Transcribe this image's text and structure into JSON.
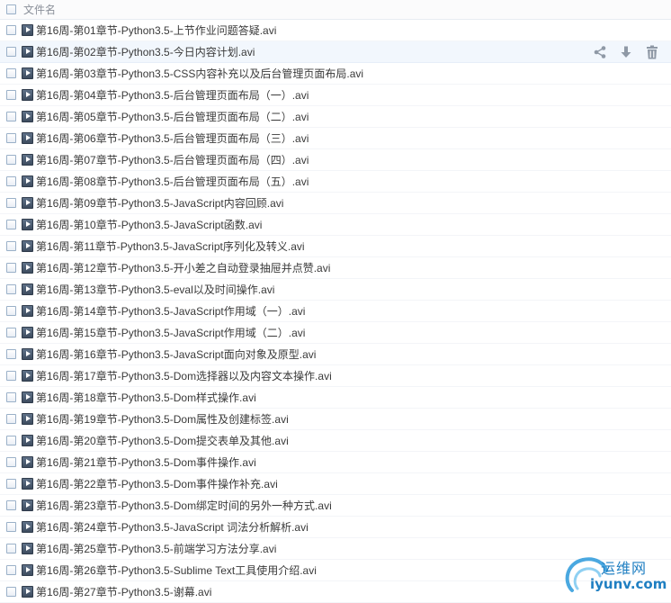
{
  "header": {
    "column_label": "文件名"
  },
  "files": [
    "第16周-第01章节-Python3.5-上节作业问题答疑.avi",
    "第16周-第02章节-Python3.5-今日内容计划.avi",
    "第16周-第03章节-Python3.5-CSS内容补充以及后台管理页面布局.avi",
    "第16周-第04章节-Python3.5-后台管理页面布局（一）.avi",
    "第16周-第05章节-Python3.5-后台管理页面布局（二）.avi",
    "第16周-第06章节-Python3.5-后台管理页面布局（三）.avi",
    "第16周-第07章节-Python3.5-后台管理页面布局（四）.avi",
    "第16周-第08章节-Python3.5-后台管理页面布局（五）.avi",
    "第16周-第09章节-Python3.5-JavaScript内容回顾.avi",
    "第16周-第10章节-Python3.5-JavaScript函数.avi",
    "第16周-第11章节-Python3.5-JavaScript序列化及转义.avi",
    "第16周-第12章节-Python3.5-开小差之自动登录抽屉并点赞.avi",
    "第16周-第13章节-Python3.5-eval以及时间操作.avi",
    "第16周-第14章节-Python3.5-JavaScript作用域（一）.avi",
    "第16周-第15章节-Python3.5-JavaScript作用域（二）.avi",
    "第16周-第16章节-Python3.5-JavaScript面向对象及原型.avi",
    "第16周-第17章节-Python3.5-Dom选择器以及内容文本操作.avi",
    "第16周-第18章节-Python3.5-Dom样式操作.avi",
    "第16周-第19章节-Python3.5-Dom属性及创建标签.avi",
    "第16周-第20章节-Python3.5-Dom提交表单及其他.avi",
    "第16周-第21章节-Python3.5-Dom事件操作.avi",
    "第16周-第22章节-Python3.5-Dom事件操作补充.avi",
    "第16周-第23章节-Python3.5-Dom绑定时间的另外一种方式.avi",
    "第16周-第24章节-Python3.5-JavaScript 词法分析解析.avi",
    "第16周-第25章节-Python3.5-前端学习方法分享.avi",
    "第16周-第26章节-Python3.5-Sublime Text工具使用介绍.avi",
    "第16周-第27章节-Python3.5-谢幕.avi"
  ],
  "hovered_row_index": 1,
  "row_actions": [
    "share-icon",
    "download-icon",
    "trash-icon"
  ],
  "watermark": {
    "title": "运维网",
    "url": "iyunv.com"
  },
  "colors": {
    "accent": "#1f7fc2",
    "hover_bg": "#f2f7fd",
    "icon_gray": "#8f99a6"
  }
}
